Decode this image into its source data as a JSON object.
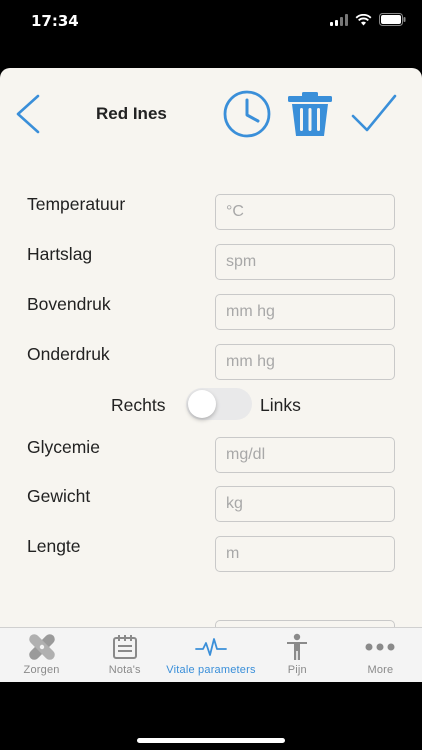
{
  "status_bar": {
    "time": "17:34"
  },
  "header": {
    "title": "Red Ines"
  },
  "colors": {
    "accent": "#3a8fd9",
    "background": "#f7f5f0",
    "toggle_off": "#e9e9ea"
  },
  "form": {
    "fields": [
      {
        "label": "Temperatuur",
        "placeholder": "°C",
        "value": ""
      },
      {
        "label": "Hartslag",
        "placeholder": "spm",
        "value": ""
      },
      {
        "label": "Bovendruk",
        "placeholder": "mm hg",
        "value": ""
      },
      {
        "label": "Onderdruk",
        "placeholder": "mm hg",
        "value": ""
      },
      {
        "label": "Glycemie",
        "placeholder": "mg/dl",
        "value": ""
      },
      {
        "label": "Gewicht",
        "placeholder": "kg",
        "value": ""
      },
      {
        "label": "Lengte",
        "placeholder": "m",
        "value": ""
      }
    ],
    "side_toggle": {
      "left_label": "Rechts",
      "right_label": "Links",
      "on": false
    }
  },
  "tabs": [
    {
      "label": "Zorgen",
      "icon": "bandage-icon",
      "active": false
    },
    {
      "label": "Nota's",
      "icon": "notes-icon",
      "active": false
    },
    {
      "label": "Vitale parameters",
      "icon": "pulse-icon",
      "active": true
    },
    {
      "label": "Pijn",
      "icon": "person-icon",
      "active": false
    },
    {
      "label": "More",
      "icon": "more-icon",
      "active": false
    }
  ]
}
